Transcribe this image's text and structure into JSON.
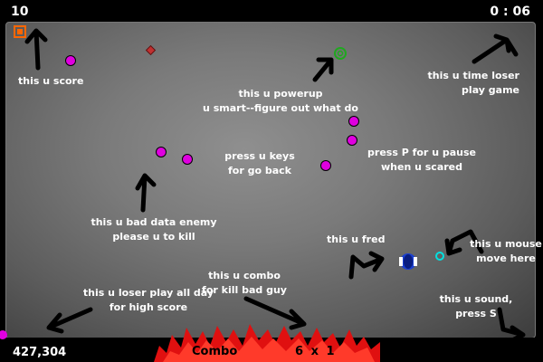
{
  "hud": {
    "score": "10",
    "time": "0 : 06",
    "high_score": "427,304"
  },
  "combo": {
    "label": "Combo",
    "value": "6 x 1"
  },
  "notes": {
    "score": "this u score",
    "powerup": "this u powerup\nu smart--figure out what do",
    "time": "this u time loser\nplay game",
    "keys": "press u keys\nfor go back",
    "pause": "press P for u pause\nwhen u scared",
    "enemy": "this u bad data enemy\nplease u to kill",
    "fred": "this u fred",
    "mouse": "this u mouse\nmove here",
    "combo": "this u combo\nfor kill bad guy",
    "loser": "this u loser play all day\nfor high score",
    "sound": "this u sound,\npress S"
  },
  "colors": {
    "enemy": "#e000e0",
    "powerup": "#1fa81f",
    "player": "#1b3fd0",
    "cursor": "#00e0e0",
    "flame": "#ff1a1a",
    "score_icon": "#ff6600"
  }
}
